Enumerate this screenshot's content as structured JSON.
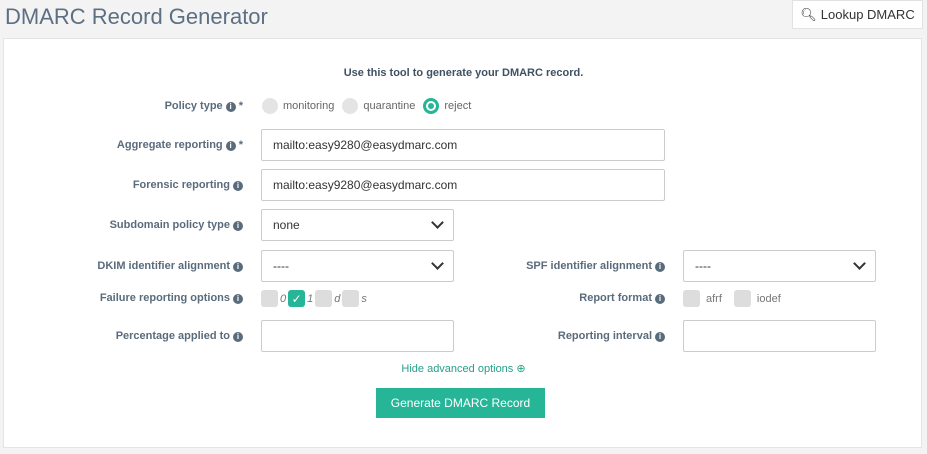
{
  "title": "DMARC Record Generator",
  "lookup_label": "Lookup DMARC",
  "intro": "Use this tool to generate your DMARC record.",
  "policy": {
    "label": "Policy type",
    "required": "*",
    "options": [
      "monitoring",
      "quarantine",
      "reject"
    ],
    "selected": "reject"
  },
  "aggregate": {
    "label": "Aggregate reporting",
    "required": "*",
    "value": "mailto:easy9280@easydmarc.com"
  },
  "forensic": {
    "label": "Forensic reporting",
    "value": "mailto:easy9280@easydmarc.com"
  },
  "subdomain": {
    "label": "Subdomain policy type",
    "value": "none"
  },
  "dkim": {
    "label": "DKIM identifier alignment",
    "value": "----"
  },
  "spf": {
    "label": "SPF identifier alignment",
    "value": "----"
  },
  "failure": {
    "label": "Failure reporting options",
    "options": [
      {
        "label": "0",
        "checked": false
      },
      {
        "label": "1",
        "checked": true
      },
      {
        "label": "d",
        "checked": false
      },
      {
        "label": "s",
        "checked": false
      }
    ]
  },
  "report_format": {
    "label": "Report format",
    "options": [
      {
        "label": "afrf",
        "checked": false
      },
      {
        "label": "iodef",
        "checked": false
      }
    ]
  },
  "percentage": {
    "label": "Percentage applied to",
    "value": ""
  },
  "interval": {
    "label": "Reporting interval",
    "value": ""
  },
  "hide_advanced": "Hide advanced options",
  "generate": "Generate DMARC Record",
  "accent": "#26b597"
}
